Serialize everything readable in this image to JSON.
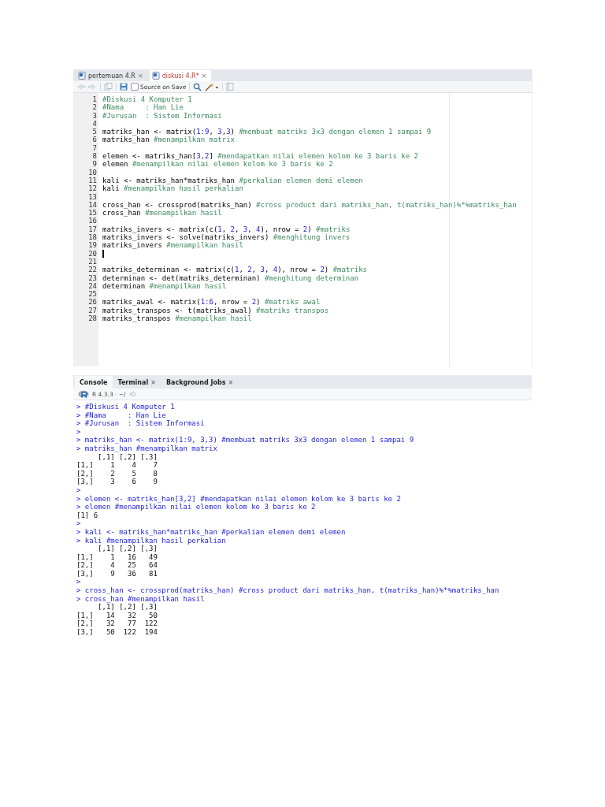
{
  "editor": {
    "tabs": [
      {
        "label": "pertemuan 4.R",
        "selected": false,
        "close": "×"
      },
      {
        "label": "diskusi 4.R*",
        "selected": true,
        "close": "×"
      }
    ],
    "source_on_save": {
      "label": "Source on Save",
      "checked": false
    },
    "lines": [
      {
        "number": "1",
        "cursor": false,
        "segments": [
          {
            "kind": "comment",
            "text": "#Diskusi 4 Komputer 1"
          }
        ]
      },
      {
        "number": "2",
        "cursor": false,
        "segments": [
          {
            "kind": "comment",
            "text": "#Nama     : Han Lie"
          }
        ]
      },
      {
        "number": "3",
        "cursor": false,
        "segments": [
          {
            "kind": "comment",
            "text": "#Jurusan  : Sistem Informasi"
          }
        ]
      },
      {
        "number": "4",
        "cursor": false
      },
      {
        "number": "5",
        "cursor": false,
        "segments": [
          {
            "kind": "code",
            "text": "matriks_han <- matrix("
          },
          {
            "kind": "number",
            "text": "1:9"
          },
          {
            "kind": "code",
            "text": ", "
          },
          {
            "kind": "number",
            "text": "3"
          },
          {
            "kind": "code",
            "text": ","
          },
          {
            "kind": "number",
            "text": "3"
          },
          {
            "kind": "code",
            "text": ") "
          },
          {
            "kind": "comment",
            "text": "#membuat matriks 3x3 dengan elemen 1 sampai 9"
          }
        ]
      },
      {
        "number": "6",
        "cursor": false,
        "segments": [
          {
            "kind": "code",
            "text": "matriks_han "
          },
          {
            "kind": "comment",
            "text": "#menampilkan matrix"
          }
        ]
      },
      {
        "number": "7",
        "cursor": false
      },
      {
        "number": "8",
        "cursor": false,
        "segments": [
          {
            "kind": "code",
            "text": "elemen <- matriks_han["
          },
          {
            "kind": "number",
            "text": "3,2"
          },
          {
            "kind": "code",
            "text": "] "
          },
          {
            "kind": "comment",
            "text": "#mendapatkan nilai elemen kolom ke 3 baris ke 2"
          }
        ]
      },
      {
        "number": "9",
        "cursor": false,
        "segments": [
          {
            "kind": "code",
            "text": "elemen "
          },
          {
            "kind": "comment",
            "text": "#menampilkan nilai elemen kolom ke 3 baris ke 2"
          }
        ]
      },
      {
        "number": "10",
        "cursor": false
      },
      {
        "number": "11",
        "cursor": false,
        "segments": [
          {
            "kind": "code",
            "text": "kali <- matriks_han*matriks_han "
          },
          {
            "kind": "comment",
            "text": "#perkalian elemen demi elemen"
          }
        ]
      },
      {
        "number": "12",
        "cursor": false,
        "segments": [
          {
            "kind": "code",
            "text": "kali "
          },
          {
            "kind": "comment",
            "text": "#menampilkan hasil perkalian"
          }
        ]
      },
      {
        "number": "13",
        "cursor": false
      },
      {
        "number": "14",
        "cursor": false,
        "segments": [
          {
            "kind": "code",
            "text": "cross_han <- crossprod(matriks_han) "
          },
          {
            "kind": "comment",
            "text": "#cross product dari matriks_han, t(matriks_han)%*%matriks_han"
          }
        ]
      },
      {
        "number": "15",
        "cursor": false,
        "segments": [
          {
            "kind": "code",
            "text": "cross_han "
          },
          {
            "kind": "comment",
            "text": "#menampilkan hasil"
          }
        ]
      },
      {
        "number": "16",
        "cursor": false
      },
      {
        "number": "17",
        "cursor": false,
        "segments": [
          {
            "kind": "code",
            "text": "matriks_invers <- matrix(c("
          },
          {
            "kind": "number",
            "text": "1"
          },
          {
            "kind": "code",
            "text": ", "
          },
          {
            "kind": "number",
            "text": "2"
          },
          {
            "kind": "code",
            "text": ", "
          },
          {
            "kind": "number",
            "text": "3"
          },
          {
            "kind": "code",
            "text": ", "
          },
          {
            "kind": "number",
            "text": "4"
          },
          {
            "kind": "code",
            "text": "), nrow = "
          },
          {
            "kind": "number",
            "text": "2"
          },
          {
            "kind": "code",
            "text": ") "
          },
          {
            "kind": "comment",
            "text": "#matriks"
          }
        ]
      },
      {
        "number": "18",
        "cursor": false,
        "segments": [
          {
            "kind": "code",
            "text": "matriks_invers <- solve(matriks_invers) "
          },
          {
            "kind": "comment",
            "text": "#menghitung invers"
          }
        ]
      },
      {
        "number": "19",
        "cursor": false,
        "segments": [
          {
            "kind": "code",
            "text": "matriks_invers "
          },
          {
            "kind": "comment",
            "text": "#menampilkan hasil"
          }
        ]
      },
      {
        "number": "20",
        "cursor": true
      },
      {
        "number": "21",
        "cursor": false
      },
      {
        "number": "22",
        "cursor": false,
        "segments": [
          {
            "kind": "code",
            "text": "matriks_determinan <- matrix(c("
          },
          {
            "kind": "number",
            "text": "1"
          },
          {
            "kind": "code",
            "text": ", "
          },
          {
            "kind": "number",
            "text": "2"
          },
          {
            "kind": "code",
            "text": ", "
          },
          {
            "kind": "number",
            "text": "3"
          },
          {
            "kind": "code",
            "text": ", "
          },
          {
            "kind": "number",
            "text": "4"
          },
          {
            "kind": "code",
            "text": "), nrow = "
          },
          {
            "kind": "number",
            "text": "2"
          },
          {
            "kind": "code",
            "text": ") "
          },
          {
            "kind": "comment",
            "text": "#matriks"
          }
        ]
      },
      {
        "number": "23",
        "cursor": false,
        "segments": [
          {
            "kind": "code",
            "text": "determinan <- det(matriks_determinan) "
          },
          {
            "kind": "comment",
            "text": "#menghitung determinan"
          }
        ]
      },
      {
        "number": "24",
        "cursor": false,
        "segments": [
          {
            "kind": "code",
            "text": "determinan "
          },
          {
            "kind": "comment",
            "text": "#menampilkan hasil"
          }
        ]
      },
      {
        "number": "25",
        "cursor": false
      },
      {
        "number": "26",
        "cursor": false,
        "segments": [
          {
            "kind": "code",
            "text": "matriks_awal <- matrix("
          },
          {
            "kind": "number",
            "text": "1:6"
          },
          {
            "kind": "code",
            "text": ", nrow = "
          },
          {
            "kind": "number",
            "text": "2"
          },
          {
            "kind": "code",
            "text": ") "
          },
          {
            "kind": "comment",
            "text": "#matriks awal"
          }
        ]
      },
      {
        "number": "27",
        "cursor": false,
        "segments": [
          {
            "kind": "code",
            "text": "matriks_transpos <- t(matriks_awal) "
          },
          {
            "kind": "comment",
            "text": "#matriks transpos"
          }
        ]
      },
      {
        "number": "28",
        "cursor": false,
        "segments": [
          {
            "kind": "code",
            "text": "matriks_transpos "
          },
          {
            "kind": "comment",
            "text": "#menampilkan hasil"
          }
        ]
      }
    ]
  },
  "console": {
    "tabs": [
      {
        "label": "Console",
        "selected": true
      },
      {
        "label": "Terminal",
        "selected": false,
        "close": "×"
      },
      {
        "label": "Background Jobs",
        "selected": false,
        "close": "×"
      }
    ],
    "version": "R 4.3.3 · ~/",
    "lines": [
      {
        "kind": "input",
        "text": "> #Diskusi 4 Komputer 1"
      },
      {
        "kind": "input",
        "text": "> #Nama     : Han Lie"
      },
      {
        "kind": "input",
        "text": "> #Jurusan  : Sistem Informasi"
      },
      {
        "kind": "input",
        "text": ">"
      },
      {
        "kind": "input",
        "text": "> matriks_han <- matrix(1:9, 3,3) #membuat matriks 3x3 dengan elemen 1 sampai 9"
      },
      {
        "kind": "input",
        "text": "> matriks_han #menampilkan matrix"
      },
      {
        "kind": "output",
        "text": "     [,1] [,2] [,3]"
      },
      {
        "kind": "output",
        "text": "[1,]    1    4    7"
      },
      {
        "kind": "output",
        "text": "[2,]    2    5    8"
      },
      {
        "kind": "output",
        "text": "[3,]    3    6    9"
      },
      {
        "kind": "input",
        "text": ">"
      },
      {
        "kind": "input",
        "text": "> elemen <- matriks_han[3,2] #mendapatkan nilai elemen kolom ke 3 baris ke 2"
      },
      {
        "kind": "input",
        "text": "> elemen #menampilkan nilai elemen kolom ke 3 baris ke 2"
      },
      {
        "kind": "output",
        "text": "[1] 6"
      },
      {
        "kind": "input",
        "text": ">"
      },
      {
        "kind": "input",
        "text": "> kali <- matriks_han*matriks_han #perkalian elemen demi elemen"
      },
      {
        "kind": "input",
        "text": "> kali #menampilkan hasil perkalian"
      },
      {
        "kind": "output",
        "text": "     [,1] [,2] [,3]"
      },
      {
        "kind": "output",
        "text": "[1,]    1   16   49"
      },
      {
        "kind": "output",
        "text": "[2,]    4   25   64"
      },
      {
        "kind": "output",
        "text": "[3,]    9   36   81"
      },
      {
        "kind": "input",
        "text": ">"
      },
      {
        "kind": "input",
        "text": "> cross_han <- crossprod(matriks_han) #cross product dari matriks_han, t(matriks_han)%*%matriks_han"
      },
      {
        "kind": "input",
        "text": "> cross_han #menampilkan hasil"
      },
      {
        "kind": "output",
        "text": "     [,1] [,2] [,3]"
      },
      {
        "kind": "output",
        "text": "[1,]   14   32   50"
      },
      {
        "kind": "output",
        "text": "[2,]   32   77  122"
      },
      {
        "kind": "output",
        "text": "[3,]   50  122  194"
      }
    ]
  }
}
